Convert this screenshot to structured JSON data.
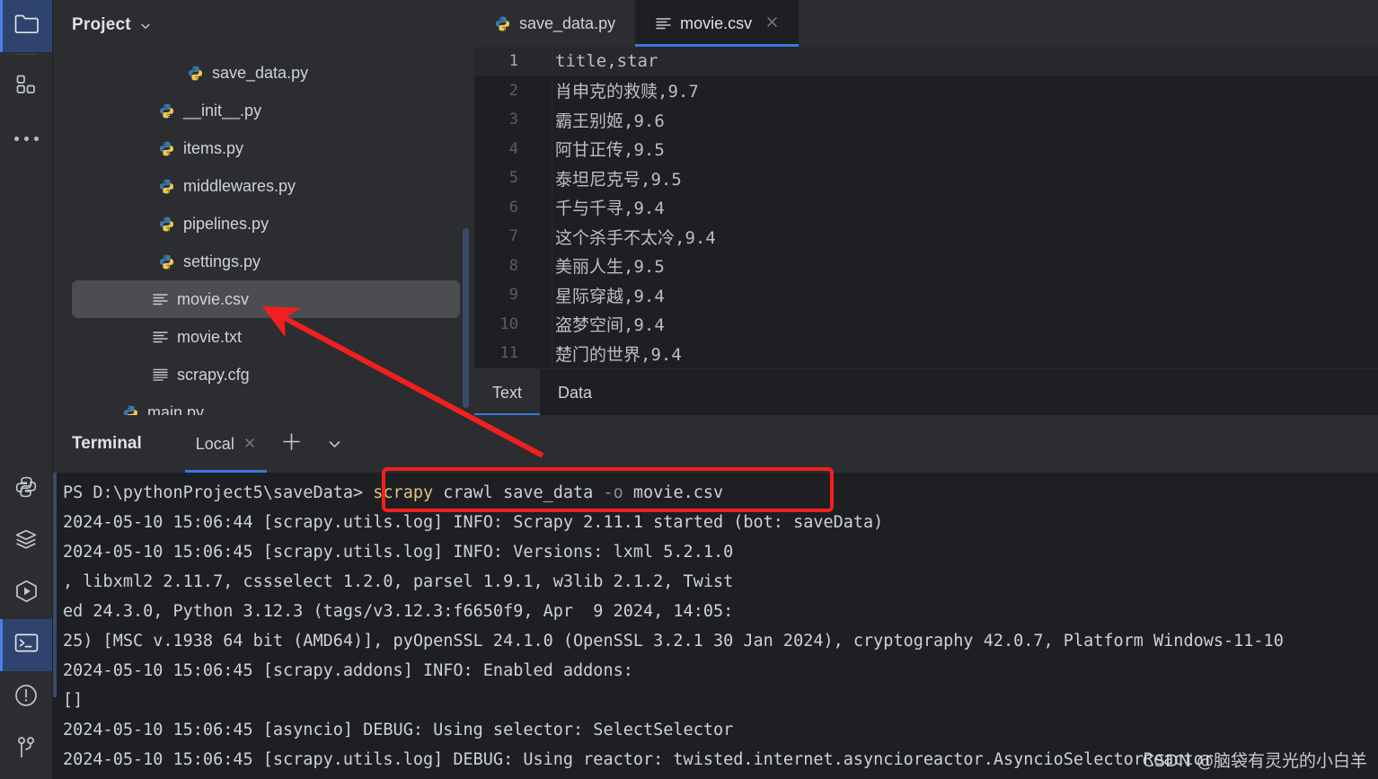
{
  "app": {
    "theme_bg": "#1e1f22",
    "panel_bg": "#2b2d30",
    "accent_blue": "#3b78db",
    "selection_blue": "#2e436e",
    "annotation_red": "#f11f1f"
  },
  "rail": {
    "top_items": [
      {
        "name": "project-folder",
        "label": "Project",
        "icon": "folder-icon",
        "active": true
      },
      {
        "name": "structure",
        "label": "Structure",
        "icon": "structure-icon",
        "active": false
      },
      {
        "name": "more",
        "label": "More tool windows",
        "icon": "more-dots-icon",
        "active": false
      }
    ],
    "bottom_items": [
      {
        "name": "python-console",
        "label": "Python Console",
        "icon": "python-icon",
        "active": false
      },
      {
        "name": "services",
        "label": "Services",
        "icon": "layers-icon",
        "active": false
      },
      {
        "name": "run",
        "label": "Run",
        "icon": "play-hex-icon",
        "active": false
      },
      {
        "name": "terminal",
        "label": "Terminal",
        "icon": "terminal-icon",
        "active": true
      },
      {
        "name": "problems",
        "label": "Problems",
        "icon": "warning-circle-icon",
        "active": false
      },
      {
        "name": "version-control",
        "label": "Version Control",
        "icon": "git-branch-icon",
        "active": false
      }
    ]
  },
  "project": {
    "title": "Project",
    "dropdown_icon": "chevron-down-icon",
    "files": [
      {
        "name": "save_data.py",
        "icon": "python-file-icon",
        "indent": 3,
        "selected": false
      },
      {
        "name": "__init__.py",
        "icon": "python-file-icon",
        "indent": 2,
        "selected": false
      },
      {
        "name": "items.py",
        "icon": "python-file-icon",
        "indent": 2,
        "selected": false
      },
      {
        "name": "middlewares.py",
        "icon": "python-file-icon",
        "indent": 2,
        "selected": false
      },
      {
        "name": "pipelines.py",
        "icon": "python-file-icon",
        "indent": 2,
        "selected": false
      },
      {
        "name": "settings.py",
        "icon": "python-file-icon",
        "indent": 2,
        "selected": false
      },
      {
        "name": "movie.csv",
        "icon": "text-file-icon",
        "indent": 2,
        "selected": true
      },
      {
        "name": "movie.txt",
        "icon": "text-file-icon",
        "indent": 2,
        "selected": false
      },
      {
        "name": "scrapy.cfg",
        "icon": "config-file-icon",
        "indent": 2,
        "selected": false
      },
      {
        "name": "main.py",
        "icon": "python-file-icon",
        "indent": 1,
        "selected": false
      }
    ]
  },
  "editor": {
    "tabs": [
      {
        "label": "save_data.py",
        "icon": "python-file-icon",
        "active": false,
        "closable": false
      },
      {
        "label": "movie.csv",
        "icon": "text-file-icon",
        "active": true,
        "closable": true
      }
    ],
    "close_icon": "close-icon",
    "lines": [
      {
        "n": "1",
        "text": "title,star"
      },
      {
        "n": "2",
        "text": "肖申克的救赎,9.7"
      },
      {
        "n": "3",
        "text": "霸王别姬,9.6"
      },
      {
        "n": "4",
        "text": "阿甘正传,9.5"
      },
      {
        "n": "5",
        "text": "泰坦尼克号,9.5"
      },
      {
        "n": "6",
        "text": "千与千寻,9.4"
      },
      {
        "n": "7",
        "text": "这个杀手不太冷,9.4"
      },
      {
        "n": "8",
        "text": "美丽人生,9.5"
      },
      {
        "n": "9",
        "text": "星际穿越,9.4"
      },
      {
        "n": "10",
        "text": "盗梦空间,9.4"
      },
      {
        "n": "11",
        "text": "楚门的世界,9.4"
      }
    ],
    "bottom_tabs": [
      {
        "label": "Text",
        "active": true
      },
      {
        "label": "Data",
        "active": false
      }
    ]
  },
  "terminal": {
    "title": "Terminal",
    "session_tab": "Local",
    "close_icon": "close-icon",
    "add_icon": "plus-icon",
    "options_icon": "chevron-down-icon",
    "prompt": "PS D:\\pythonProject5\\saveData>",
    "command": {
      "program": "scrapy",
      "args": "crawl save_data ",
      "flag": "-o",
      "target": " movie.csv"
    },
    "output": [
      "2024-05-10 15:06:44 [scrapy.utils.log] INFO: Scrapy 2.11.1 started (bot: saveData)",
      "2024-05-10 15:06:45 [scrapy.utils.log] INFO: Versions: lxml 5.2.1.0",
      ", libxml2 2.11.7, cssselect 1.2.0, parsel 1.9.1, w3lib 2.1.2, Twist",
      "ed 24.3.0, Python 3.12.3 (tags/v3.12.3:f6650f9, Apr  9 2024, 14:05:",
      "25) [MSC v.1938 64 bit (AMD64)], pyOpenSSL 24.1.0 (OpenSSL 3.2.1 30 Jan 2024), cryptography 42.0.7, Platform Windows-11-10",
      "2024-05-10 15:06:45 [scrapy.addons] INFO: Enabled addons:",
      "[]",
      "2024-05-10 15:06:45 [asyncio] DEBUG: Using selector: SelectSelector",
      "2024-05-10 15:06:45 [scrapy.utils.log] DEBUG: Using reactor: twisted.internet.asyncioreactor.AsyncioSelectorReactor"
    ]
  },
  "annotations": {
    "command_highlight_box": "scrapy crawl save_data -o movie.csv",
    "arrow_points_to": "movie.csv",
    "watermark": "CSDN @脑袋有灵光的小白羊"
  }
}
